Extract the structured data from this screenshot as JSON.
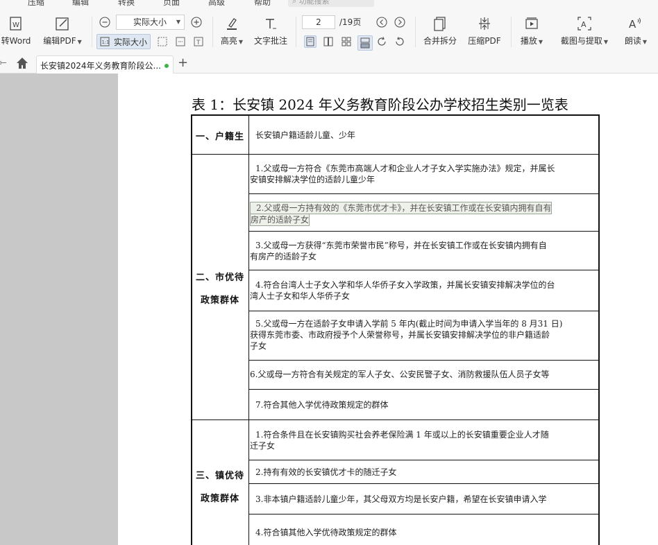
{
  "menubar": {
    "items": [
      "压缩",
      "编辑",
      "转换",
      "页面",
      "高级",
      "帮助"
    ],
    "search_placeholder": "功能搜索"
  },
  "toolbar": {
    "to_word": "转Word",
    "edit_pdf": "编辑PDF",
    "zoom_value": "实际大小",
    "actual_size": "实际大小",
    "highlight": "高亮",
    "text_note": "文字批注",
    "page_current": "2",
    "page_total": "/19页",
    "merge_split": "合并拆分",
    "compress": "压缩PDF",
    "play": "播放",
    "screenshot_extract": "截图与提取",
    "read_aloud": "朗读"
  },
  "tabs": [
    {
      "label": "长安镇2024年义务教育阶段公...",
      "active": true
    }
  ],
  "document": {
    "title": "表 1：长安镇 2024 年义务教育阶段公办学校招生类别一览表",
    "rows": [
      {
        "category": "一、户籍生",
        "items": [
          "长安镇户籍适龄儿童、少年"
        ]
      },
      {
        "category_lines": [
          "二、市优待",
          "政策群体"
        ],
        "items": [
          {
            "l1": "1.父或母一方符合《东莞市高端人才和企业人才子女入学实施办法》规定，并属长",
            "l2": "安镇安排解决学位的适龄儿童少年"
          },
          {
            "l1": "2.父或母一方持有效的《东莞市优才卡》，并在长安镇工作或在长安镇内拥有自有",
            "l2": "房产的适龄子女"
          },
          {
            "l1": "3.父或母一方获得“东莞市荣誉市民”称号，并在长安镇工作或在长安镇内拥有自",
            "l2": "有房产的适龄子女"
          },
          {
            "l1": "4.符合台湾人士子女入学和华人华侨子女入学政策，并属长安镇安排解决学位的台",
            "l2": "湾人士子女和华人华侨子女"
          },
          {
            "l1": "5.父或母一方在适龄子女申请入学前 5 年内(截止时间为申请入学当年的 8 月31 日)",
            "l2": "获得东莞市委、市政府授予个人荣誉称号，并属长安镇安排解决学位的非户籍适龄",
            "l3": "子女"
          },
          {
            "l1": "6.父或母一方符合有关规定的军人子女、公安民警子女、消防救援队伍人员子女等"
          },
          {
            "l1": "7.符合其他入学优待政策规定的群体"
          }
        ]
      },
      {
        "category_lines": [
          "三、镇优待",
          "政策群体"
        ],
        "items": [
          {
            "l1": "1.符合条件且在长安镇购买社会养老保险满 1 年或以上的长安镇重要企业人才随",
            "l2": "迁子女"
          },
          {
            "l1": "2.持有有效的长安镇优才卡的随迁子女"
          },
          {
            "l1": "3.非本镇户籍适龄儿童少年，其父母双方均是长安户籍，希望在长安镇申请入学"
          },
          {
            "l1": "4.符合镇其他入学优待政策规定的群体"
          }
        ]
      }
    ]
  },
  "colors": {
    "accent": "#3cb449",
    "panel_gray": "#c8c8c8",
    "toolbar_bg": "#f7f7f7"
  }
}
